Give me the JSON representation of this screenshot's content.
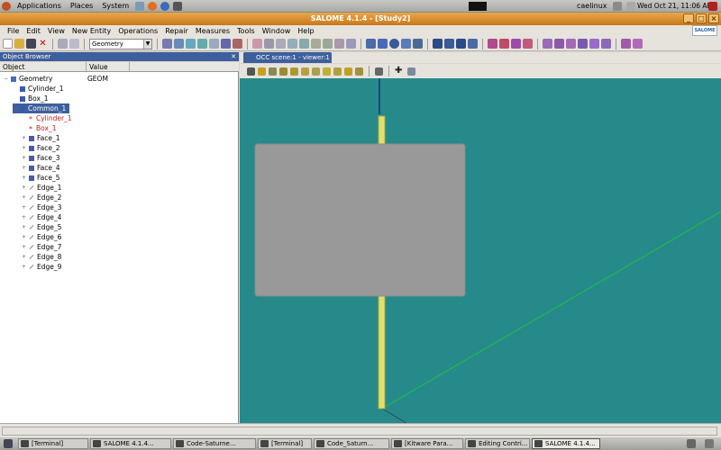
{
  "top_panel": {
    "menus": [
      "Applications",
      "Places",
      "System"
    ],
    "username": "caelinux",
    "clock": "Wed Oct 21, 11:06 AM"
  },
  "window": {
    "title": "SALOME 4.1.4 - [Study2]",
    "controls": [
      "_",
      "□",
      "×"
    ]
  },
  "menubar": {
    "items": [
      "File",
      "Edit",
      "View",
      "New Entity",
      "Operations",
      "Repair",
      "Measures",
      "Tools",
      "Window",
      "Help"
    ],
    "logo": "SALOME"
  },
  "toolbar": {
    "module": "Geometry"
  },
  "object_browser": {
    "title": "Object Browser",
    "columns": [
      "Object",
      "Value"
    ],
    "rows": [
      {
        "label": "Geometry",
        "value": "GEOM",
        "indent": 0,
        "icon": "geometry-icon"
      },
      {
        "label": "Cylinder_1",
        "value": "",
        "indent": 1,
        "icon": "cylinder-icon"
      },
      {
        "label": "Box_1",
        "value": "",
        "indent": 1,
        "icon": "box-icon"
      },
      {
        "label": "Common_1",
        "value": "",
        "indent": 1,
        "icon": "common-icon",
        "selected": true
      },
      {
        "label": "Cylinder_1",
        "value": "",
        "indent": 2,
        "icon": "reference-icon",
        "ref": true
      },
      {
        "label": "Box_1",
        "value": "",
        "indent": 2,
        "icon": "reference-icon",
        "ref": true
      },
      {
        "label": "Face_1",
        "value": "",
        "indent": 2,
        "icon": "face-icon"
      },
      {
        "label": "Face_2",
        "value": "",
        "indent": 2,
        "icon": "face-icon"
      },
      {
        "label": "Face_3",
        "value": "",
        "indent": 2,
        "icon": "face-icon"
      },
      {
        "label": "Face_4",
        "value": "",
        "indent": 2,
        "icon": "face-icon"
      },
      {
        "label": "Face_5",
        "value": "",
        "indent": 2,
        "icon": "face-icon"
      },
      {
        "label": "Edge_1",
        "value": "",
        "indent": 2,
        "icon": "edge-icon"
      },
      {
        "label": "Edge_2",
        "value": "",
        "indent": 2,
        "icon": "edge-icon"
      },
      {
        "label": "Edge_3",
        "value": "",
        "indent": 2,
        "icon": "edge-icon"
      },
      {
        "label": "Edge_4",
        "value": "",
        "indent": 2,
        "icon": "edge-icon"
      },
      {
        "label": "Edge_5",
        "value": "",
        "indent": 2,
        "icon": "edge-icon"
      },
      {
        "label": "Edge_6",
        "value": "",
        "indent": 2,
        "icon": "edge-icon"
      },
      {
        "label": "Edge_7",
        "value": "",
        "indent": 2,
        "icon": "edge-icon"
      },
      {
        "label": "Edge_8",
        "value": "",
        "indent": 2,
        "icon": "edge-icon"
      },
      {
        "label": "Edge_9",
        "value": "",
        "indent": 2,
        "icon": "edge-icon"
      }
    ]
  },
  "viewer": {
    "tab": "OCC scene:1 - viewer:1",
    "background": "#268a8a"
  },
  "taskbar": {
    "items": [
      {
        "label": "[Terminal]",
        "active": false
      },
      {
        "label": "SALOME 4.1.4...",
        "active": false
      },
      {
        "label": "Code-Saturne...",
        "active": false
      },
      {
        "label": "[Terminal]",
        "active": false
      },
      {
        "label": "Code_Saturn...",
        "active": false
      },
      {
        "label": "[Kitware Para...",
        "active": false
      },
      {
        "label": "Editing Contri...",
        "active": false
      },
      {
        "label": "SALOME 4.1.4...",
        "active": true
      }
    ]
  }
}
